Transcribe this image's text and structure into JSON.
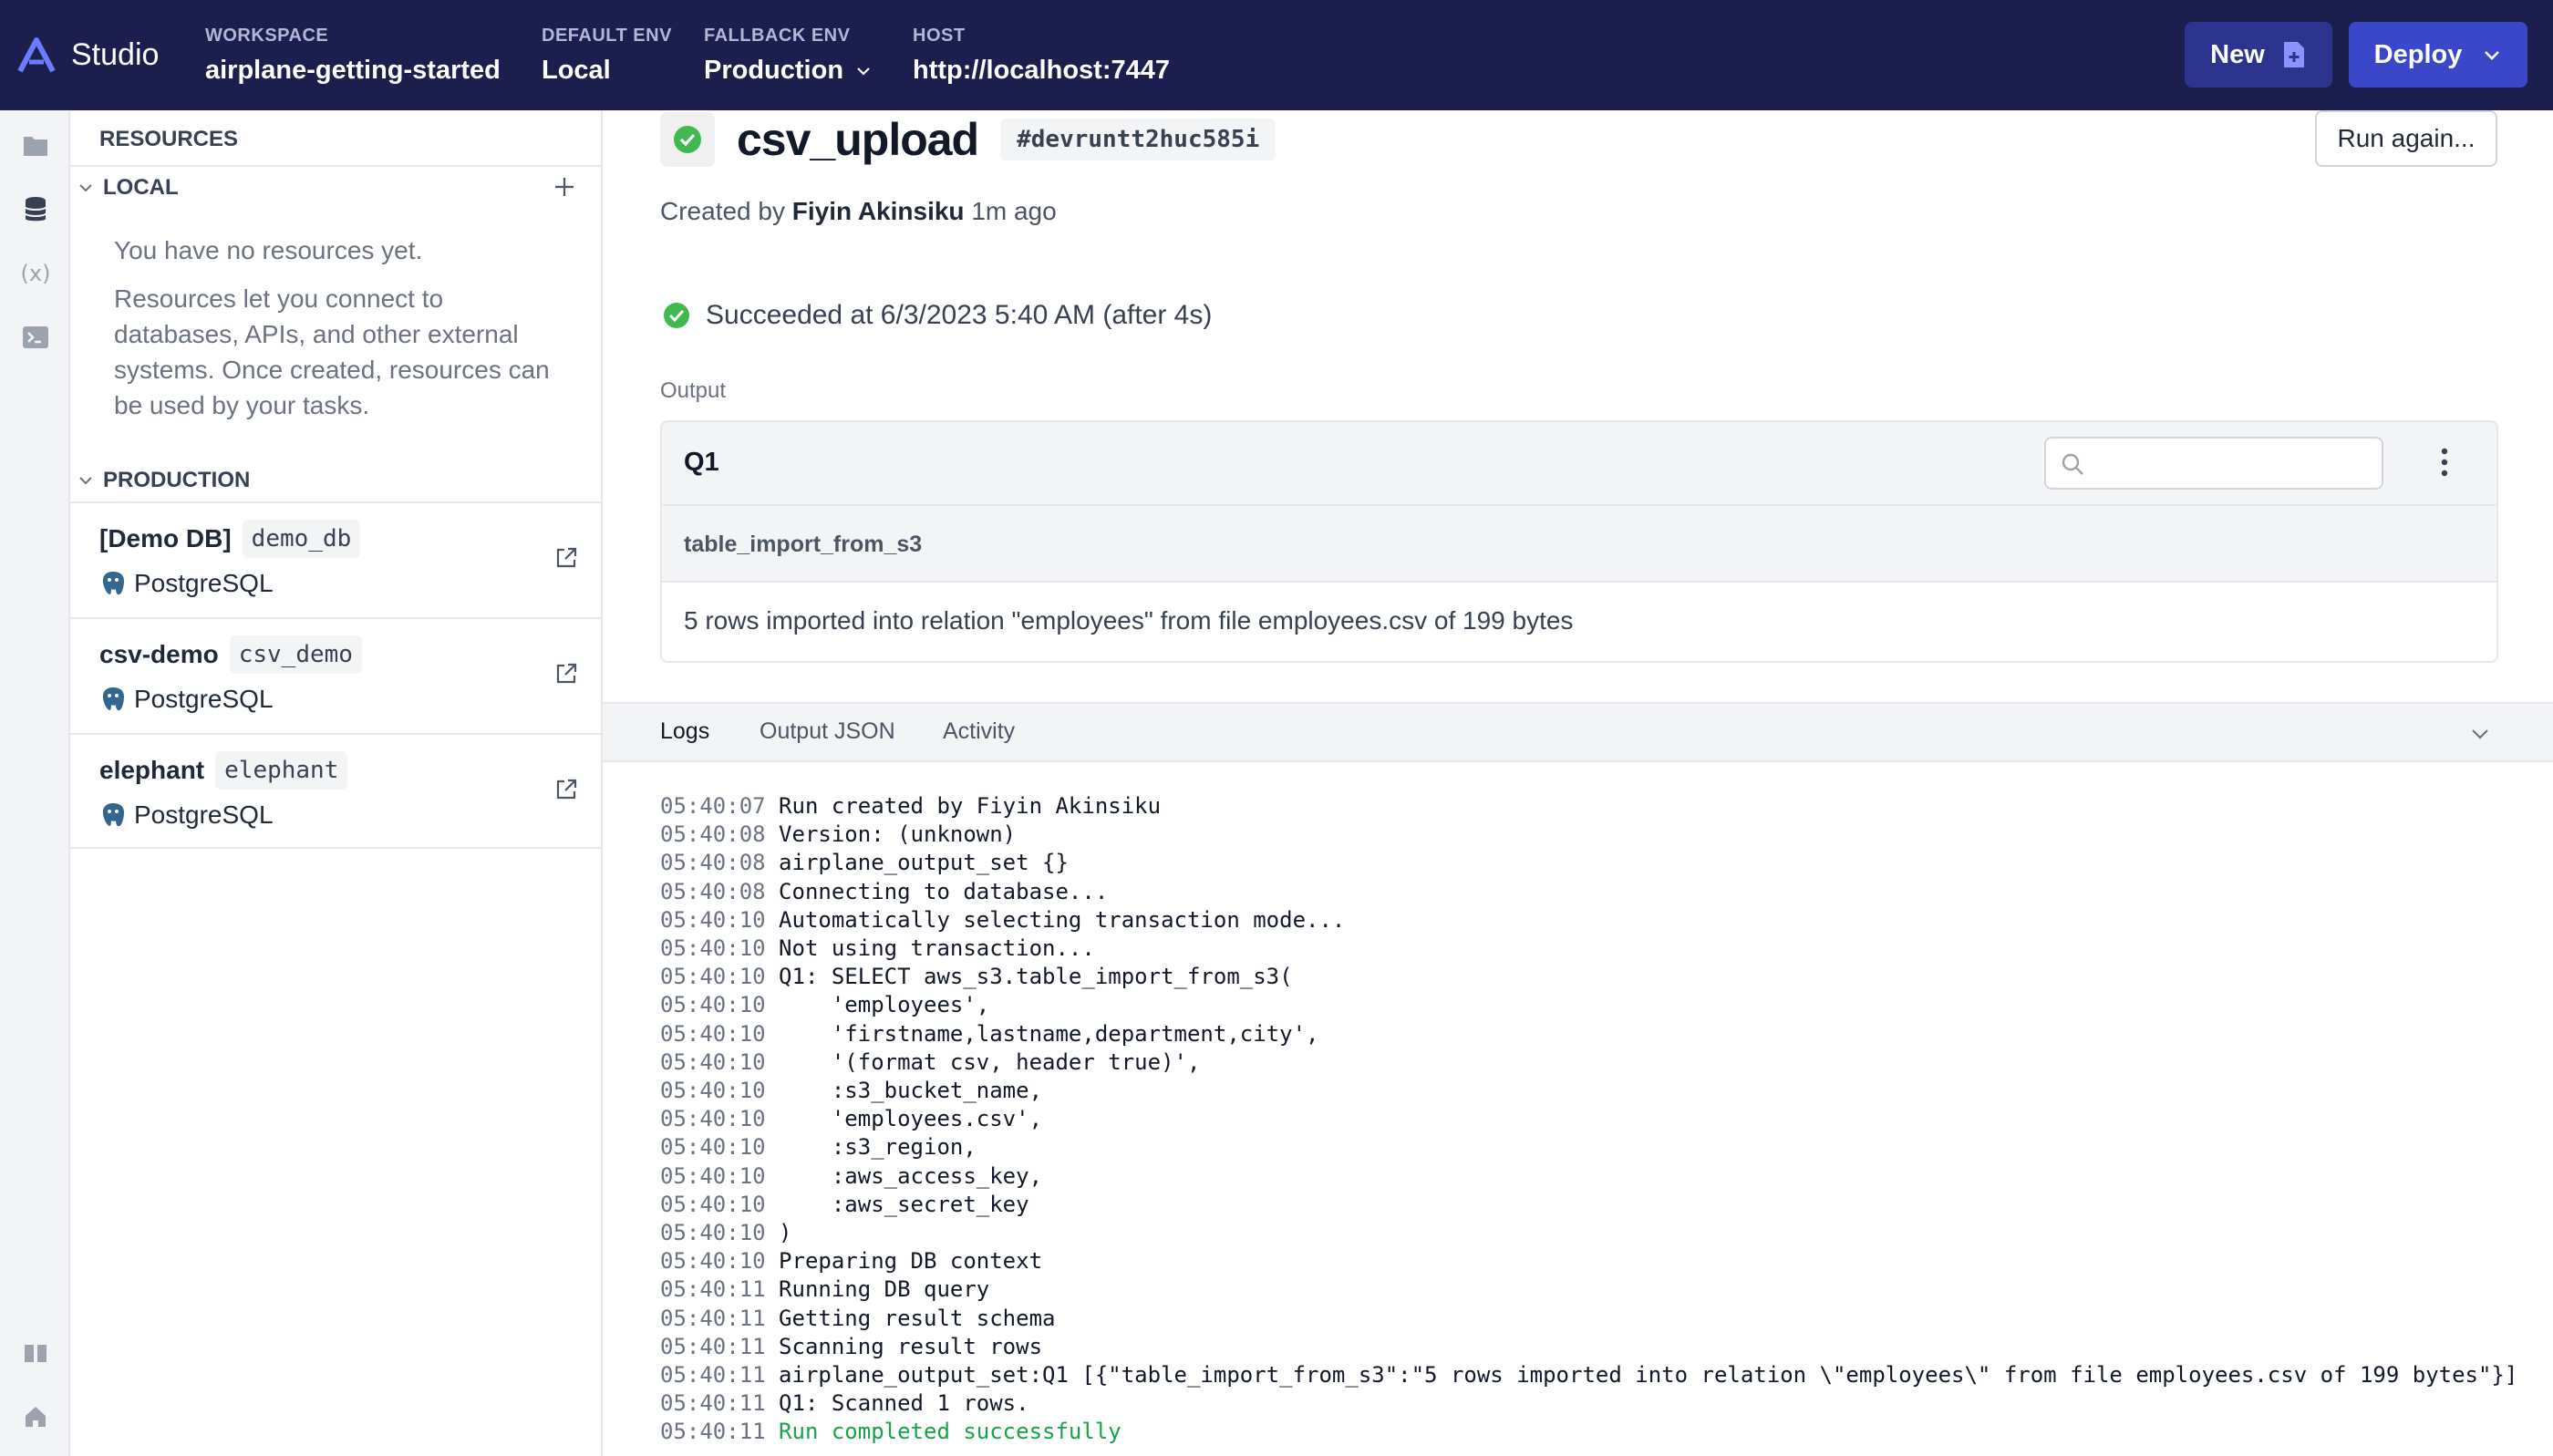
{
  "topbar": {
    "brand": "Studio",
    "workspace_label": "WORKSPACE",
    "workspace_value": "airplane-getting-started",
    "default_env_label": "DEFAULT ENV",
    "default_env_value": "Local",
    "fallback_env_label": "FALLBACK ENV",
    "fallback_env_value": "Production",
    "host_label": "HOST",
    "host_value": "http://localhost:7447",
    "new_label": "New",
    "deploy_label": "Deploy"
  },
  "resources": {
    "header": "RESOURCES",
    "local_label": "LOCAL",
    "empty_title": "You have no resources yet.",
    "empty_body": "Resources let you connect to databases, APIs, and other external systems. Once created, resources can be used by your tasks.",
    "production_label": "PRODUCTION",
    "items": [
      {
        "name": "[Demo DB]",
        "slug": "demo_db",
        "type": "PostgreSQL"
      },
      {
        "name": "csv-demo",
        "slug": "csv_demo",
        "type": "PostgreSQL"
      },
      {
        "name": "elephant",
        "slug": "elephant",
        "type": "PostgreSQL"
      }
    ]
  },
  "run": {
    "title": "csv_upload",
    "id": "#devruntt2huc585i",
    "run_again": "Run again...",
    "created_prefix": "Created by",
    "created_by": "Fiyin Akinsiku",
    "created_ago": "1m ago",
    "status": "Succeeded at 6/3/2023 5:40 AM (after 4s)"
  },
  "output": {
    "label": "Output",
    "query": "Q1",
    "search_placeholder": "",
    "column": "table_import_from_s3",
    "cell": "5 rows imported into relation \"employees\" from file employees.csv of 199 bytes"
  },
  "tabs": [
    "Logs",
    "Output JSON",
    "Activity"
  ],
  "logs": [
    {
      "ts": "05:40:07",
      "msg": "Run created by Fiyin Akinsiku"
    },
    {
      "ts": "05:40:08",
      "msg": "Version: (unknown)"
    },
    {
      "ts": "05:40:08",
      "msg": "airplane_output_set {}"
    },
    {
      "ts": "05:40:08",
      "msg": "Connecting to database..."
    },
    {
      "ts": "05:40:10",
      "msg": "Automatically selecting transaction mode..."
    },
    {
      "ts": "05:40:10",
      "msg": "Not using transaction..."
    },
    {
      "ts": "05:40:10",
      "msg": "Q1: SELECT aws_s3.table_import_from_s3("
    },
    {
      "ts": "05:40:10",
      "msg": "    'employees',"
    },
    {
      "ts": "05:40:10",
      "msg": "    'firstname,lastname,department,city',"
    },
    {
      "ts": "05:40:10",
      "msg": "    '(format csv, header true)',"
    },
    {
      "ts": "05:40:10",
      "msg": "    :s3_bucket_name,"
    },
    {
      "ts": "05:40:10",
      "msg": "    'employees.csv',"
    },
    {
      "ts": "05:40:10",
      "msg": "    :s3_region,"
    },
    {
      "ts": "05:40:10",
      "msg": "    :aws_access_key,"
    },
    {
      "ts": "05:40:10",
      "msg": "    :aws_secret_key"
    },
    {
      "ts": "05:40:10",
      "msg": ")"
    },
    {
      "ts": "05:40:10",
      "msg": "Preparing DB context"
    },
    {
      "ts": "05:40:11",
      "msg": "Running DB query"
    },
    {
      "ts": "05:40:11",
      "msg": "Getting result schema"
    },
    {
      "ts": "05:40:11",
      "msg": "Scanning result rows"
    },
    {
      "ts": "05:40:11",
      "msg": "airplane_output_set:Q1 [{\"table_import_from_s3\":\"5 rows imported into relation \\\"employees\\\" from file employees.csv of 199 bytes\"}]"
    },
    {
      "ts": "05:40:11",
      "msg": "Q1: Scanned 1 rows."
    },
    {
      "ts": "05:40:11",
      "msg": "Run completed successfully",
      "success": true
    }
  ],
  "colors": {
    "topbar": "#1c1f4e",
    "new_button": "#2d348d",
    "deploy_button": "#3a47c8",
    "success": "#16a34a"
  }
}
